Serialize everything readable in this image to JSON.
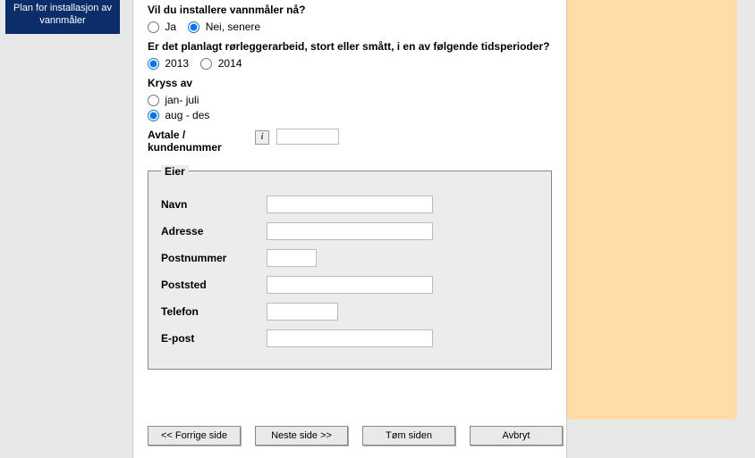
{
  "sidebar": {
    "item_line1": "Plan for installasjon av",
    "item_line2": "vannmåler"
  },
  "form": {
    "q1": {
      "text": "Vil du installere vannmåler nå?",
      "opt_yes": "Ja",
      "opt_no": "Nei, senere",
      "selected": "no"
    },
    "q2": {
      "text": "Er det planlagt rørleggerarbeid, stort eller smått, i en av følgende tidsperioder?",
      "opt_a": "2013",
      "opt_b": "2014",
      "selected": "a"
    },
    "q3": {
      "text": "Kryss av",
      "opt_a": "jan- juli",
      "opt_b": "aug - des",
      "selected": "b"
    },
    "avtale": {
      "label": "Avtale / kundenummer",
      "value": ""
    },
    "eier": {
      "legend": "Eier",
      "navn_label": "Navn",
      "navn_value": "",
      "adresse_label": "Adresse",
      "adresse_value": "",
      "postnummer_label": "Postnummer",
      "postnummer_value": "",
      "poststed_label": "Poststed",
      "poststed_value": "",
      "telefon_label": "Telefon",
      "telefon_value": "",
      "epost_label": "E-post",
      "epost_value": ""
    }
  },
  "buttons": {
    "prev": "<< Forrige side",
    "next": "Neste side >>",
    "clear": "Tøm siden",
    "cancel": "Avbryt"
  }
}
